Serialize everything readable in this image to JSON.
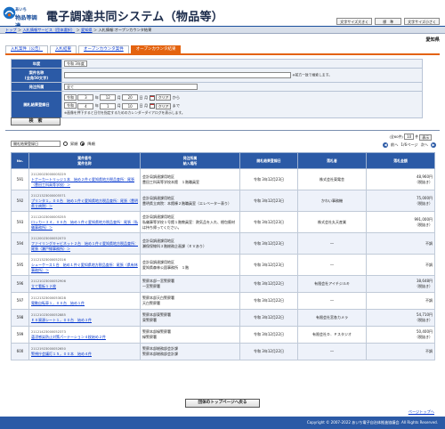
{
  "header": {
    "logo_small": "あいち",
    "logo_big": "物品等調達",
    "title": "電子調達共同システム（物品等）",
    "buttons": [
      "文字サイズ大きく",
      "標　準",
      "文字サイズ小さく"
    ]
  },
  "breadcrumb": {
    "items": [
      "トップ",
      "入札情報サービス（団体選択）",
      "愛知県",
      "入札情報:オープンカウンタ結果"
    ],
    "seps": [
      "＞",
      "＞",
      "＞"
    ]
  },
  "region": "愛知県",
  "tabs": [
    "入札案件（公告）",
    "入札結果",
    "オープンカウンタ案件",
    "オープンカウンタ結果"
  ],
  "form": {
    "year_label": "年度",
    "year_value": "令和 3年度",
    "name_label": "案件名称",
    "name_sub": "(全角50文字)",
    "name_note": "※前方一致で検索します。",
    "dept_label": "発注所属",
    "dept_value": "全て",
    "date_label": "開札結果登録日",
    "era": "令和",
    "from": {
      "y": "3",
      "m": "12",
      "d": "20",
      "dow": "月"
    },
    "to": {
      "y": "4",
      "m": "1",
      "d": "10",
      "dow": "月"
    },
    "u_year": "年",
    "u_month": "月",
    "u_day": "日",
    "kara": "から",
    "made": "まで",
    "clear": "クリア",
    "cal_note": "※画像を押下すると日付を指定するためのカレンダーダイアログを表示します。",
    "search_btn": "検　索"
  },
  "list": {
    "count_text": "(全60件)",
    "per_page": "10",
    "per_page_unit": "件",
    "page_indicator": "表示",
    "page_of": "前へ",
    "page_info": "1/6ページ",
    "next": "次へ",
    "sort_value": "開札結果登録日",
    "sort_asc": "昇順",
    "sort_desc": "降順"
  },
  "table": {
    "headers": {
      "no": "No.",
      "case": [
        "案件番号",
        "案件名称"
      ],
      "dept": [
        "発注所属",
        "納入場所"
      ],
      "date": "開札結果登録日",
      "supplier": "落札者",
      "amount": "落札金額"
    },
    "rows": [
      {
        "no": "591",
        "id": "21120023000005229",
        "name": "トナーカートリッジ１本　始め２件ぐ愛知県地方税品査所：尾張（豊田工科高等学校）＞",
        "dept": "会計局調達課用地区",
        "place": "豊田工科高等学校本館　１階職員室",
        "date": "令和 3年12月23日",
        "supplier": "株式会社東電舎",
        "amount": "48,960円",
        "tax": "（税抜き）"
      },
      {
        "no": "592",
        "id": "21121323000005571",
        "name": "プリンタ１，００台　始め１件ぐ愛知県地方税品査所：尾張（豊明県立病院）＞",
        "dept": "会計局調達課用地区",
        "place": "豊明県立病院：本館棟２階職員室（エレベーター表り）",
        "date": "令和 3年12月23日",
        "supplier": "かわい事務機",
        "amount": "75,000円",
        "tax": "（税抜き）"
      },
      {
        "no": "593",
        "id": "21112023000005255",
        "name": "ロッカー３４，００台　始め１件ぐ愛知県地方税品査所：尾張（私儀事務所）＞",
        "dept": "会計局調達課用地区",
        "place": "私儀事等学校１号館１階教員室：熱気品を入れ、梱包廃材は持ち帰ってください。",
        "date": "令和 3年12月23日",
        "supplier": "株式会社丸天産業",
        "amount": "991,000円",
        "tax": "（税抜き）"
      },
      {
        "no": "594",
        "id": "21120023000052070",
        "name": "ファイリングキャビネット２台　始め１件ぐ愛知県地方税品査所：尾張（瀬戸線事務所）＞",
        "dept": "会計局調達課用地区",
        "place": "瀬保保線科３階総務企画課（ＥＶあり）",
        "date": "令和 3年12月23日",
        "supplier": "―",
        "amount": "不調",
        "tax": ""
      },
      {
        "no": "595",
        "id": "21121323000052316",
        "name": "シューケース１台　始め１件ぐ愛知県地方税品査所：尾張（県有林事務所）＞",
        "dept": "会計局調達課用地区",
        "place": "愛知県森林公園事務所　１階",
        "date": "令和 3年12月23日",
        "supplier": "―",
        "amount": "不調",
        "tax": ""
      },
      {
        "no": "596",
        "id": "21121023000052906",
        "name": "立て看板１２枚",
        "dept": "警察本部一宮警察署",
        "place": "一宮警察署",
        "date": "令和 3年12月22日",
        "supplier": "有限会社アイチジルキ",
        "amount": "38,648円",
        "tax": "（税抜き）"
      },
      {
        "no": "597",
        "id": "21121323000053028",
        "name": "電動自転車１，００台　始め１件",
        "dept": "警察本部天白警察署",
        "place": "天白警察署",
        "date": "令和 3年12月22日",
        "supplier": "―",
        "amount": "不調",
        "tax": ""
      },
      {
        "no": "598",
        "id": "21121023000052885",
        "name": "ＥＸ資源シート１，００台　始め３件",
        "dept": "警察本部東警察署",
        "place": "東警察署",
        "date": "令和 3年12月22日",
        "supplier": "有限会社宮各カメラ",
        "amount": "54,710円",
        "tax": "（税抜き）"
      },
      {
        "no": "599",
        "id": "21121423000052373",
        "name": "颪浸感染防止対策パーテーション４枚始め２件",
        "dept": "警察本部緑警察署",
        "place": "緑警察署",
        "date": "令和 3年12月22日",
        "supplier": "有限会社Ｄ．Ｐスタジオ",
        "amount": "50,400円",
        "tax": "（税抜き）"
      },
      {
        "no": "600",
        "id": "21121923000052650",
        "name": "警視庁会議灯１５，００本　始め４件",
        "dept": "警察本部総務部会計課",
        "place": "警察本部総務部会計課",
        "date": "令和 3年12月22日",
        "supplier": "―",
        "amount": "不調",
        "tax": ""
      }
    ]
  },
  "back_button": "団体のトップページへ戻る",
  "page_top": "ページトップへ",
  "footer": "Copyright © 2007-2022 あいち電子自治体推進協議会. All Rights Reserved.",
  "colors": {
    "primary": "#2b5aa6",
    "accent": "#e4630f",
    "link": "#0033cc"
  }
}
